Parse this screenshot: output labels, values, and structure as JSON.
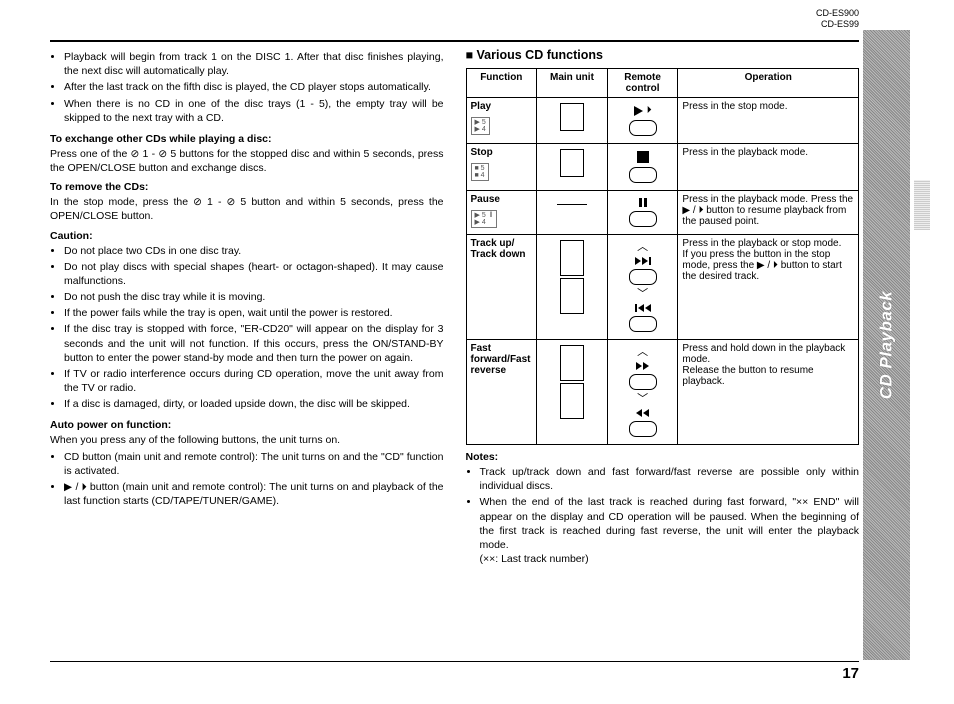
{
  "header": {
    "model1": "CD-ES900",
    "model2": "CD-ES99"
  },
  "side_tab": "CD Playback",
  "page_number": "17",
  "left": {
    "top_bullets": [
      "Playback will begin from track 1 on the DISC 1. After that disc finishes playing, the next disc will automatically play.",
      "After the last track on the fifth disc is played, the CD player stops automatically.",
      "When there is no CD in one of the disc trays (1 - 5), the empty tray will be skipped to the next tray with a CD."
    ],
    "exchange_h": "To exchange other CDs while playing a disc:",
    "exchange_p": "Press one of the ⊘ 1 - ⊘ 5 buttons for the stopped disc and within 5 seconds, press the OPEN/CLOSE button and exchange discs.",
    "remove_h": "To remove the CDs:",
    "remove_p": "In the stop mode, press the ⊘ 1 - ⊘ 5 button and within 5 seconds, press the OPEN/CLOSE button.",
    "caution_h": "Caution:",
    "caution_bullets": [
      "Do not place two CDs in one disc tray.",
      "Do not play discs with special shapes (heart- or octagon-shaped). It may cause malfunctions.",
      "Do not push the disc tray while it is moving.",
      "If the power fails while the tray is open, wait until the power is restored.",
      "If the disc tray is stopped with force, \"ER-CD20\" will appear on the display for 3 seconds and the unit will not function. If this occurs, press the ON/STAND-BY button to enter the power stand-by mode and then turn the power on again.",
      "If TV or radio interference occurs during CD operation, move the unit away from the TV or radio.",
      "If a disc is damaged, dirty, or loaded upside down, the disc will be skipped."
    ],
    "auto_h": "Auto power on function:",
    "auto_p": "When you press any of the following buttons, the unit turns on.",
    "auto_bullets": [
      "CD button (main unit and remote control): The unit turns on and the \"CD\" function is activated.",
      "▶ / ⏵ button (main unit and remote control): The unit turns on and playback of the last function starts (CD/TAPE/TUNER/GAME)."
    ]
  },
  "right": {
    "title": "Various CD functions",
    "th": {
      "function": "Function",
      "main_unit": "Main unit",
      "remote": "Remote control",
      "operation": "Operation"
    },
    "rows": [
      {
        "fn": "Play",
        "op": "Press in the stop mode."
      },
      {
        "fn": "Stop",
        "op": "Press in the playback mode."
      },
      {
        "fn": "Pause",
        "op": "Press in the playback mode. Press the ▶ / ⏵ button to resume playback from the paused point."
      },
      {
        "fn": "Track up/\nTrack down",
        "op": "Press in the playback or stop mode.\nIf you press the button in the stop mode, press the ▶ / ⏵ button to start the desired track."
      },
      {
        "fn": "Fast forward/Fast reverse",
        "op": "Press and hold down in the playback mode.\nRelease the button to resume playback."
      }
    ],
    "notes_h": "Notes:",
    "notes": [
      "Track up/track down and fast forward/fast reverse are possible only within individual discs.",
      "When the end of the last track is reached during fast forward, \"×× END\" will appear on the display and CD operation will be paused. When the beginning of the first track is reached during fast reverse, the unit will enter the playback mode.\n(××: Last track number)"
    ]
  }
}
